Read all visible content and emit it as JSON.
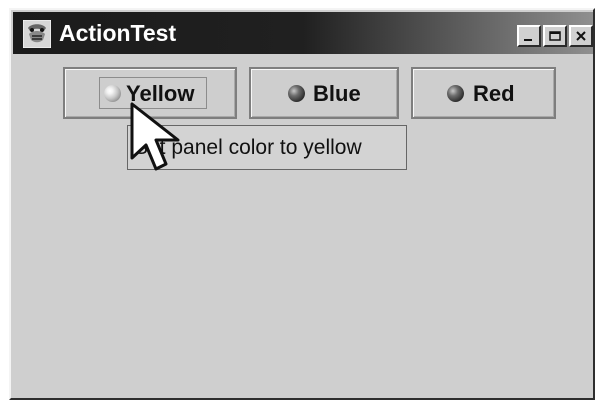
{
  "window": {
    "title": "ActionTest",
    "icon": "app-icon",
    "controls": [
      "minimize-icon",
      "maximize-icon",
      "close-icon"
    ]
  },
  "buttons": [
    {
      "label": "Yellow",
      "icon": "radio-ball-icon"
    },
    {
      "label": "Blue",
      "icon": "radio-ball-icon"
    },
    {
      "label": "Red",
      "icon": "radio-ball-icon"
    }
  ],
  "tooltip": {
    "text": "Set panel color to yellow"
  },
  "cursor": {
    "icon": "arrow-cursor-icon"
  },
  "colors": {
    "panel": "#cfcfcf",
    "titlebar_start": "#1b1b1b",
    "titlebar_end": "#8f8f8f"
  }
}
